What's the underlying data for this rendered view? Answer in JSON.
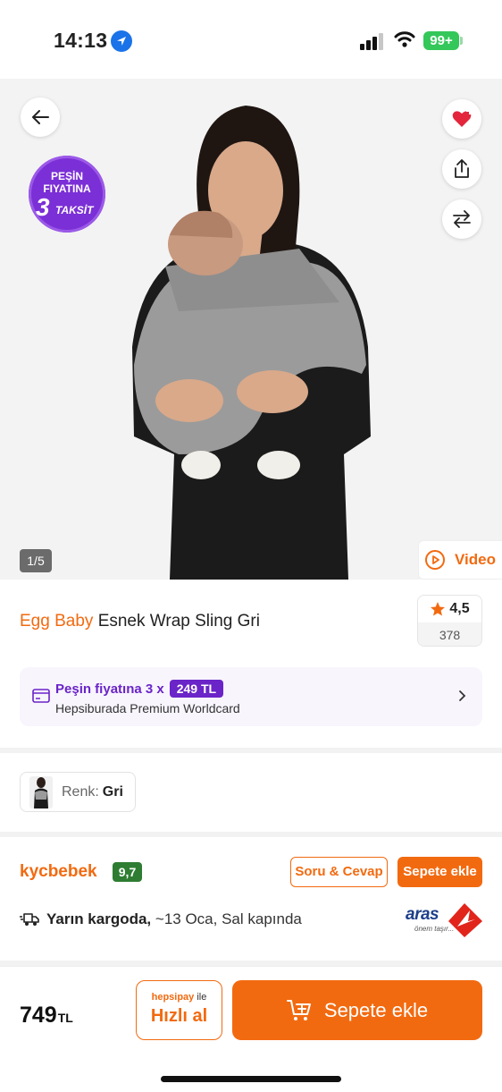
{
  "status_bar": {
    "time": "14:13",
    "battery": "99+"
  },
  "hero": {
    "badge": {
      "line1": "PEŞİN",
      "line2": "FIYATINA",
      "line3": "3",
      "line4": "TAKSİT"
    },
    "counter": "1/5",
    "video_label": "Video"
  },
  "product": {
    "brand": "Egg Baby",
    "name": "Esnek Wrap Sling Gri",
    "rating": "4,5",
    "review_count": "378"
  },
  "promo": {
    "line1": "Peşin fiyatına 3 x",
    "amount": "249 TL",
    "line2": "Hepsiburada Premium Worldcard"
  },
  "variant": {
    "label": "Renk:",
    "value": "Gri"
  },
  "seller": {
    "name": "kycbebek",
    "score": "9,7",
    "qa_label": "Soru & Cevap",
    "add_label": "Sepete ekle",
    "delivery_bold": "Yarın kargoda,",
    "delivery_rest": " ~13 Oca, Sal kapında",
    "cargo_brand": "aras",
    "cargo_tagline": "önem taşır..."
  },
  "bottom": {
    "price": "749",
    "currency": "TL",
    "pay_brand": "hepsipay",
    "pay_suffix": "ile",
    "quick_buy": "Hızlı al",
    "add_to_cart": "Sepete ekle"
  },
  "colors": {
    "accent": "#f26a10",
    "purple": "#6a24c8",
    "score_green": "#2e7d32"
  }
}
